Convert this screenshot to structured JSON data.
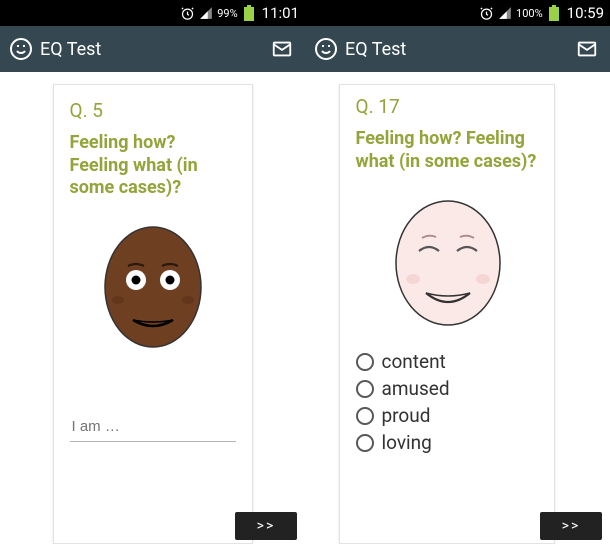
{
  "left": {
    "status": {
      "battery": "99%",
      "time": "11:01"
    },
    "app": {
      "title": "EQ Test"
    },
    "question": {
      "num": "Q. 5",
      "text": "Feeling how? Feeling what (in some cases)?"
    },
    "input": {
      "placeholder": "I am …"
    },
    "next": ">>"
  },
  "right": {
    "status": {
      "battery": "100%",
      "time": "10:59"
    },
    "app": {
      "title": "EQ Test"
    },
    "question": {
      "num": "Q. 17",
      "text": "Feeling how? Feeling what (in some cases)?"
    },
    "options": [
      "content",
      "amused",
      "proud",
      "loving"
    ],
    "next": ">>"
  }
}
